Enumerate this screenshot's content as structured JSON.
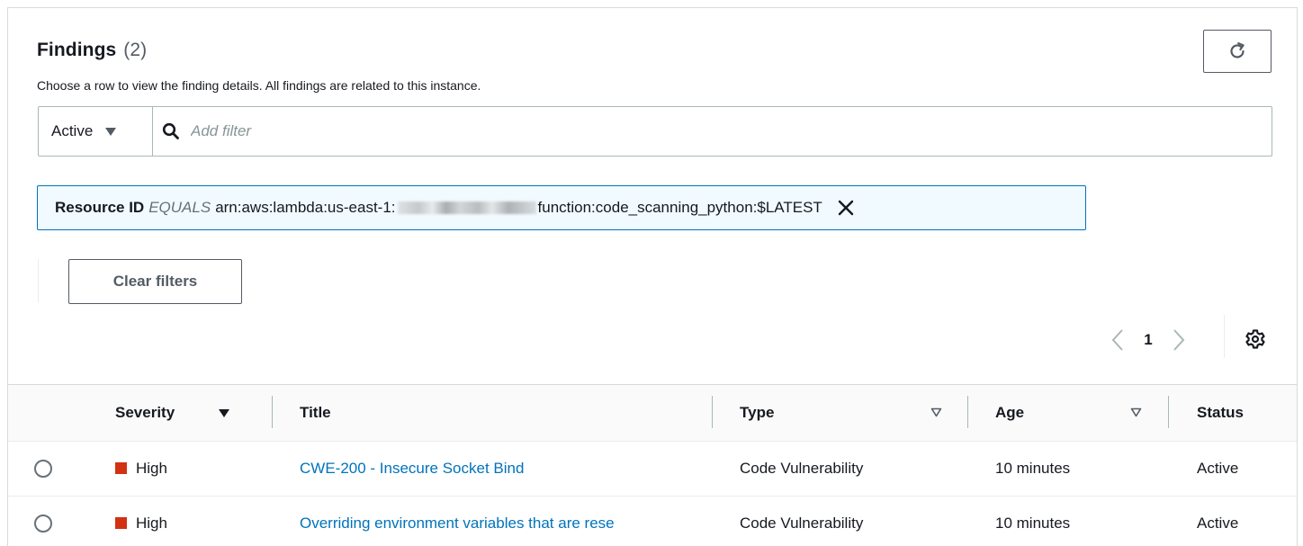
{
  "header": {
    "title": "Findings",
    "count": "(2)",
    "description": "Choose a row to view the finding details. All findings are related to this instance."
  },
  "filter": {
    "status_value": "Active",
    "placeholder": "Add filter"
  },
  "token": {
    "key": "Resource ID",
    "operator": "EQUALS",
    "value_prefix": "arn:aws:lambda:us-east-1:",
    "value_suffix": "function:code_scanning_python:$LATEST"
  },
  "clear_filters_label": "Clear filters",
  "pagination": {
    "current_page": "1"
  },
  "table": {
    "columns": [
      "Severity",
      "Title",
      "Type",
      "Age",
      "Status"
    ],
    "rows": [
      {
        "severity": "High",
        "title": "CWE-200 - Insecure Socket Bind",
        "type": "Code Vulnerability",
        "age": "10 minutes",
        "status": "Active"
      },
      {
        "severity": "High",
        "title": "Overriding environment variables that are rese",
        "type": "Code Vulnerability",
        "age": "10 minutes",
        "status": "Active"
      }
    ]
  },
  "icons": {
    "refresh": "refresh-icon",
    "search": "search-icon",
    "close": "close-icon",
    "prev": "chevron-left-icon",
    "next": "chevron-right-icon",
    "settings": "gear-icon"
  },
  "colors": {
    "link": "#0073bb",
    "severity_high": "#d13212",
    "token_background": "#f1faff",
    "token_border": "#0073bb"
  }
}
